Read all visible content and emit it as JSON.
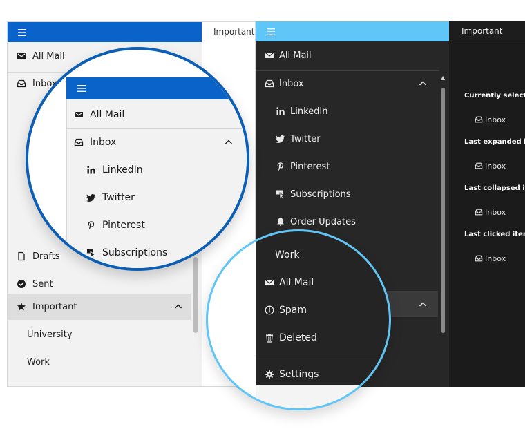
{
  "colors": {
    "light_header": "#0a63c9",
    "dark_header": "#5fc6f7",
    "light_ring": "#0c5fb4",
    "dark_ring": "#5ec5f4"
  },
  "light": {
    "content_title": "Important",
    "nav": {
      "all_mail": "All Mail",
      "inbox": "Inbox",
      "drafts": "Drafts",
      "sent": "Sent",
      "important": "Important",
      "university": "University",
      "work": "Work"
    }
  },
  "magnifier_light": {
    "all_mail": "All Mail",
    "inbox": "Inbox",
    "linkedin": "LinkedIn",
    "twitter": "Twitter",
    "pinterest": "Pinterest",
    "subscriptions": "Subscriptions"
  },
  "dark": {
    "content_title": "Important",
    "nav": {
      "all_mail": "All Mail",
      "inbox": "Inbox",
      "linkedin": "LinkedIn",
      "twitter": "Twitter",
      "pinterest": "Pinterest",
      "subscriptions": "Subscriptions",
      "order_updates": "Order Updates",
      "work": "Work",
      "all_mail_2": "All Mail",
      "spam": "Spam",
      "deleted": "Deleted",
      "settings": "Settings"
    },
    "info": [
      {
        "label": "Currently selecte",
        "value": "Inbox"
      },
      {
        "label": "Last expanded it",
        "value": "Inbox"
      },
      {
        "label": "Last collapsed ite",
        "value": "Inbox"
      },
      {
        "label": "Last clicked item",
        "value": "Inbox"
      }
    ]
  }
}
